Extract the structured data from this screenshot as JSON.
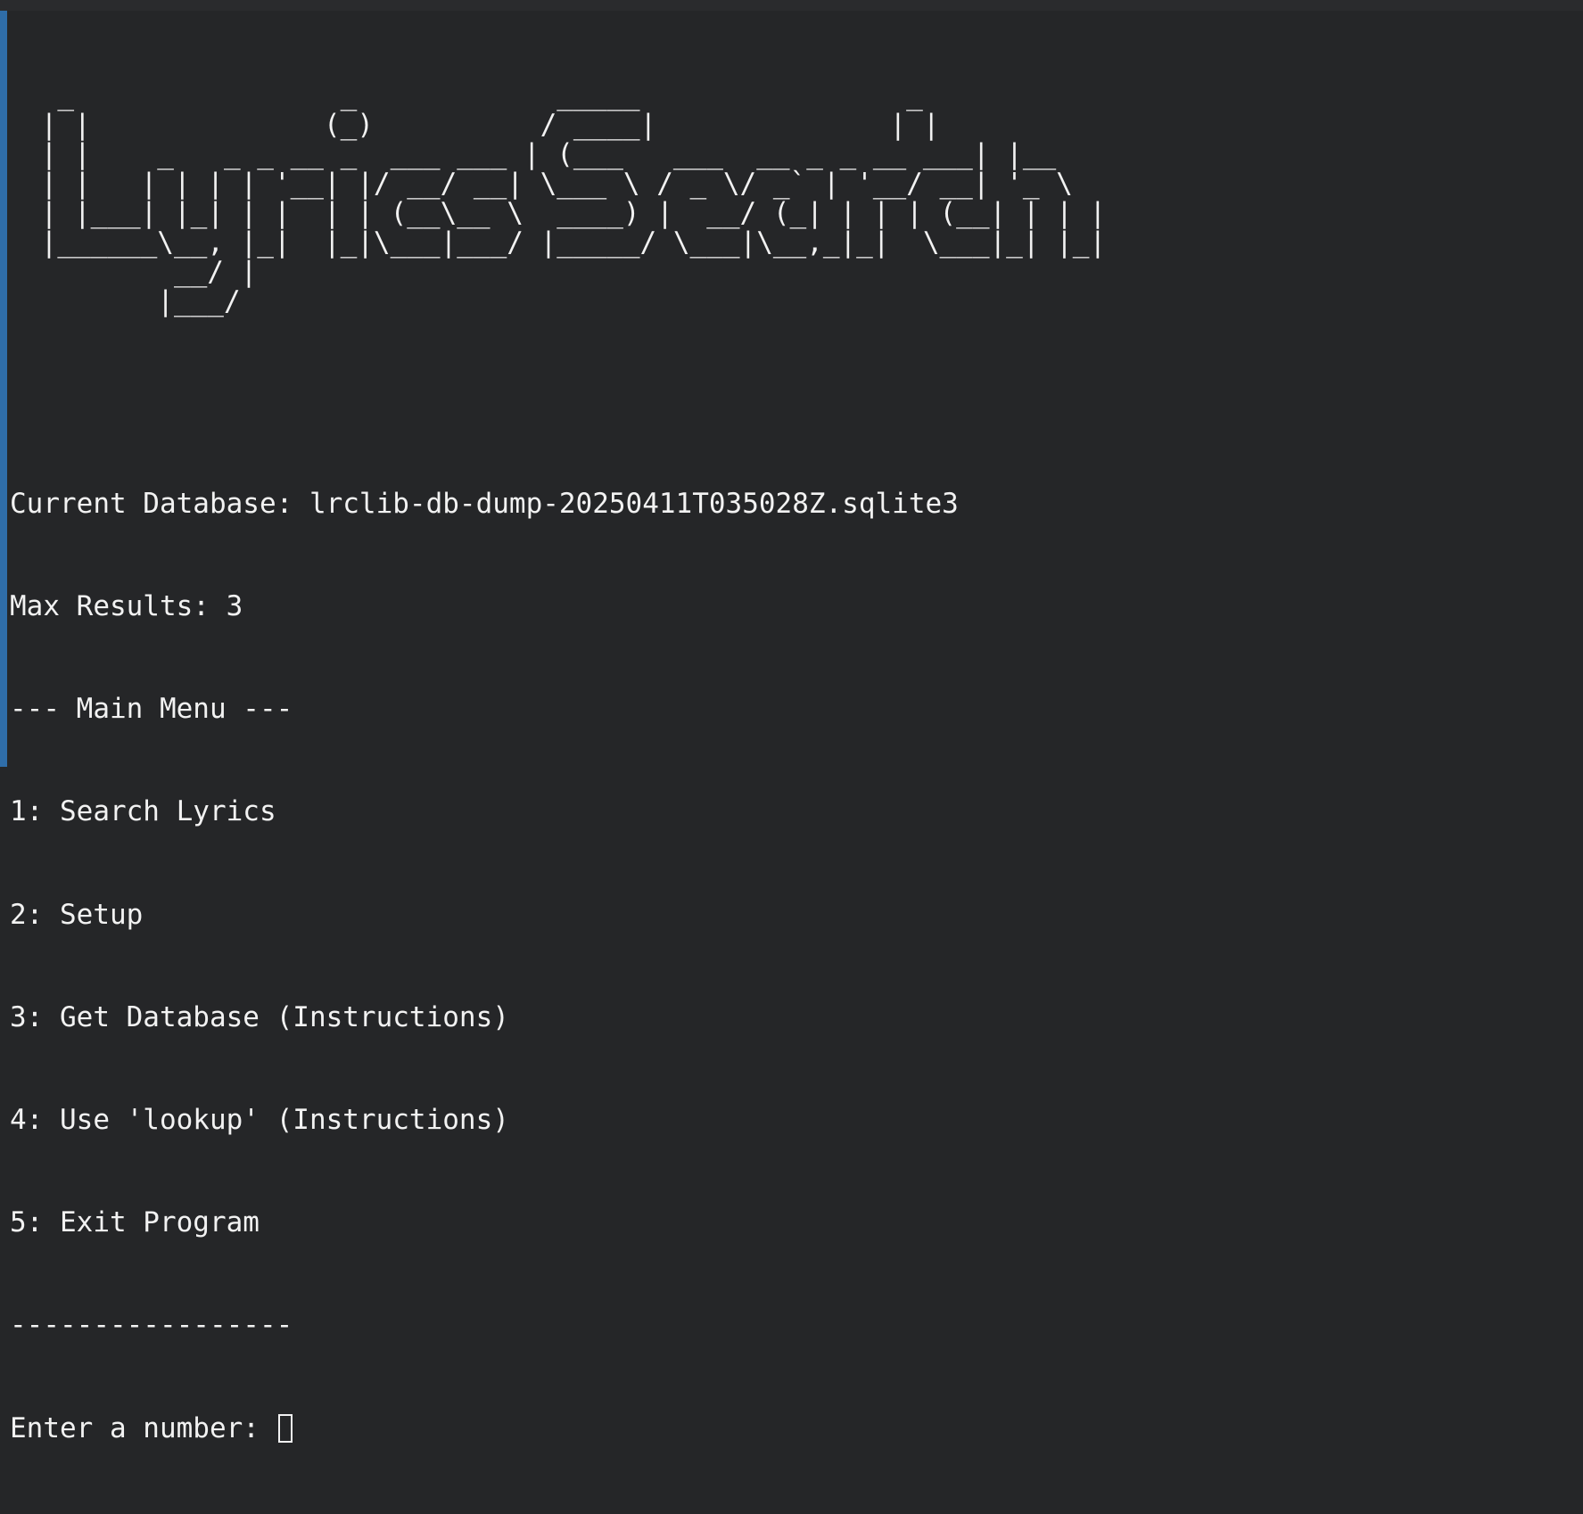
{
  "banner": {
    "art": "  _                _            _____                _     \n | |              (_)          / ____|              | |    \n | |    _   _ _ __ _  ___ ___ | (___   ___  __ _ _ __ ___| |__  \n | |   | | | | '__| |/ __/ __| \\___ \\ / _ \\/ _` | '__/ __| '_ \\ \n | |___| |_| | |  | | (__\\__ \\  ____) |  __/ (_| | | | (__| | | |\n |______\\__, |_|  |_|\\___|___/ |_____/ \\___|\\__,_|_|  \\___|_| |_|\n         __/ |                                                    \n        |___/                                                     "
  },
  "status": {
    "database": "Current Database: lrclib-db-dump-20250411T035028Z.sqlite3",
    "max_results": "Max Results: 3"
  },
  "menu": {
    "header": "--- Main Menu ---",
    "items": [
      "1: Search Lyrics",
      "2: Setup",
      "3: Get Database (Instructions)",
      "4: Use 'lookup' (Instructions)",
      "5: Exit Program"
    ],
    "footer": "-----------------"
  },
  "prompt": {
    "text": "Enter a number: ",
    "value": ""
  }
}
